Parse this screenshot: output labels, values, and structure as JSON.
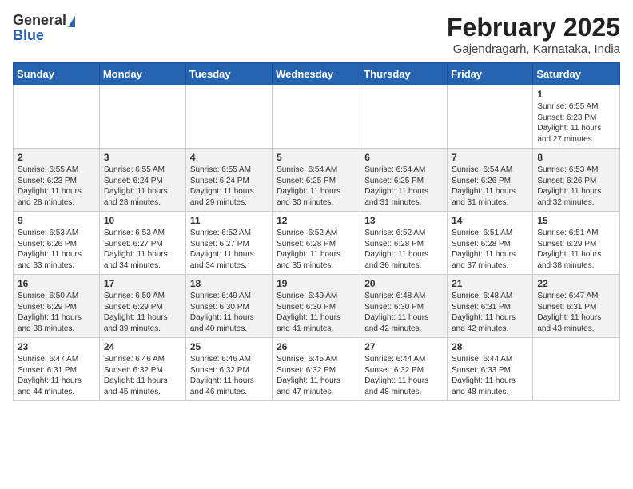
{
  "header": {
    "logo_general": "General",
    "logo_blue": "Blue",
    "month_title": "February 2025",
    "location": "Gajendragarh, Karnataka, India"
  },
  "calendar": {
    "weekdays": [
      "Sunday",
      "Monday",
      "Tuesday",
      "Wednesday",
      "Thursday",
      "Friday",
      "Saturday"
    ],
    "weeks": [
      [
        {
          "day": "",
          "info": ""
        },
        {
          "day": "",
          "info": ""
        },
        {
          "day": "",
          "info": ""
        },
        {
          "day": "",
          "info": ""
        },
        {
          "day": "",
          "info": ""
        },
        {
          "day": "",
          "info": ""
        },
        {
          "day": "1",
          "info": "Sunrise: 6:55 AM\nSunset: 6:23 PM\nDaylight: 11 hours and 27 minutes."
        }
      ],
      [
        {
          "day": "2",
          "info": "Sunrise: 6:55 AM\nSunset: 6:23 PM\nDaylight: 11 hours and 28 minutes."
        },
        {
          "day": "3",
          "info": "Sunrise: 6:55 AM\nSunset: 6:24 PM\nDaylight: 11 hours and 28 minutes."
        },
        {
          "day": "4",
          "info": "Sunrise: 6:55 AM\nSunset: 6:24 PM\nDaylight: 11 hours and 29 minutes."
        },
        {
          "day": "5",
          "info": "Sunrise: 6:54 AM\nSunset: 6:25 PM\nDaylight: 11 hours and 30 minutes."
        },
        {
          "day": "6",
          "info": "Sunrise: 6:54 AM\nSunset: 6:25 PM\nDaylight: 11 hours and 31 minutes."
        },
        {
          "day": "7",
          "info": "Sunrise: 6:54 AM\nSunset: 6:26 PM\nDaylight: 11 hours and 31 minutes."
        },
        {
          "day": "8",
          "info": "Sunrise: 6:53 AM\nSunset: 6:26 PM\nDaylight: 11 hours and 32 minutes."
        }
      ],
      [
        {
          "day": "9",
          "info": "Sunrise: 6:53 AM\nSunset: 6:26 PM\nDaylight: 11 hours and 33 minutes."
        },
        {
          "day": "10",
          "info": "Sunrise: 6:53 AM\nSunset: 6:27 PM\nDaylight: 11 hours and 34 minutes."
        },
        {
          "day": "11",
          "info": "Sunrise: 6:52 AM\nSunset: 6:27 PM\nDaylight: 11 hours and 34 minutes."
        },
        {
          "day": "12",
          "info": "Sunrise: 6:52 AM\nSunset: 6:28 PM\nDaylight: 11 hours and 35 minutes."
        },
        {
          "day": "13",
          "info": "Sunrise: 6:52 AM\nSunset: 6:28 PM\nDaylight: 11 hours and 36 minutes."
        },
        {
          "day": "14",
          "info": "Sunrise: 6:51 AM\nSunset: 6:28 PM\nDaylight: 11 hours and 37 minutes."
        },
        {
          "day": "15",
          "info": "Sunrise: 6:51 AM\nSunset: 6:29 PM\nDaylight: 11 hours and 38 minutes."
        }
      ],
      [
        {
          "day": "16",
          "info": "Sunrise: 6:50 AM\nSunset: 6:29 PM\nDaylight: 11 hours and 38 minutes."
        },
        {
          "day": "17",
          "info": "Sunrise: 6:50 AM\nSunset: 6:29 PM\nDaylight: 11 hours and 39 minutes."
        },
        {
          "day": "18",
          "info": "Sunrise: 6:49 AM\nSunset: 6:30 PM\nDaylight: 11 hours and 40 minutes."
        },
        {
          "day": "19",
          "info": "Sunrise: 6:49 AM\nSunset: 6:30 PM\nDaylight: 11 hours and 41 minutes."
        },
        {
          "day": "20",
          "info": "Sunrise: 6:48 AM\nSunset: 6:30 PM\nDaylight: 11 hours and 42 minutes."
        },
        {
          "day": "21",
          "info": "Sunrise: 6:48 AM\nSunset: 6:31 PM\nDaylight: 11 hours and 42 minutes."
        },
        {
          "day": "22",
          "info": "Sunrise: 6:47 AM\nSunset: 6:31 PM\nDaylight: 11 hours and 43 minutes."
        }
      ],
      [
        {
          "day": "23",
          "info": "Sunrise: 6:47 AM\nSunset: 6:31 PM\nDaylight: 11 hours and 44 minutes."
        },
        {
          "day": "24",
          "info": "Sunrise: 6:46 AM\nSunset: 6:32 PM\nDaylight: 11 hours and 45 minutes."
        },
        {
          "day": "25",
          "info": "Sunrise: 6:46 AM\nSunset: 6:32 PM\nDaylight: 11 hours and 46 minutes."
        },
        {
          "day": "26",
          "info": "Sunrise: 6:45 AM\nSunset: 6:32 PM\nDaylight: 11 hours and 47 minutes."
        },
        {
          "day": "27",
          "info": "Sunrise: 6:44 AM\nSunset: 6:32 PM\nDaylight: 11 hours and 48 minutes."
        },
        {
          "day": "28",
          "info": "Sunrise: 6:44 AM\nSunset: 6:33 PM\nDaylight: 11 hours and 48 minutes."
        },
        {
          "day": "",
          "info": ""
        }
      ]
    ]
  }
}
